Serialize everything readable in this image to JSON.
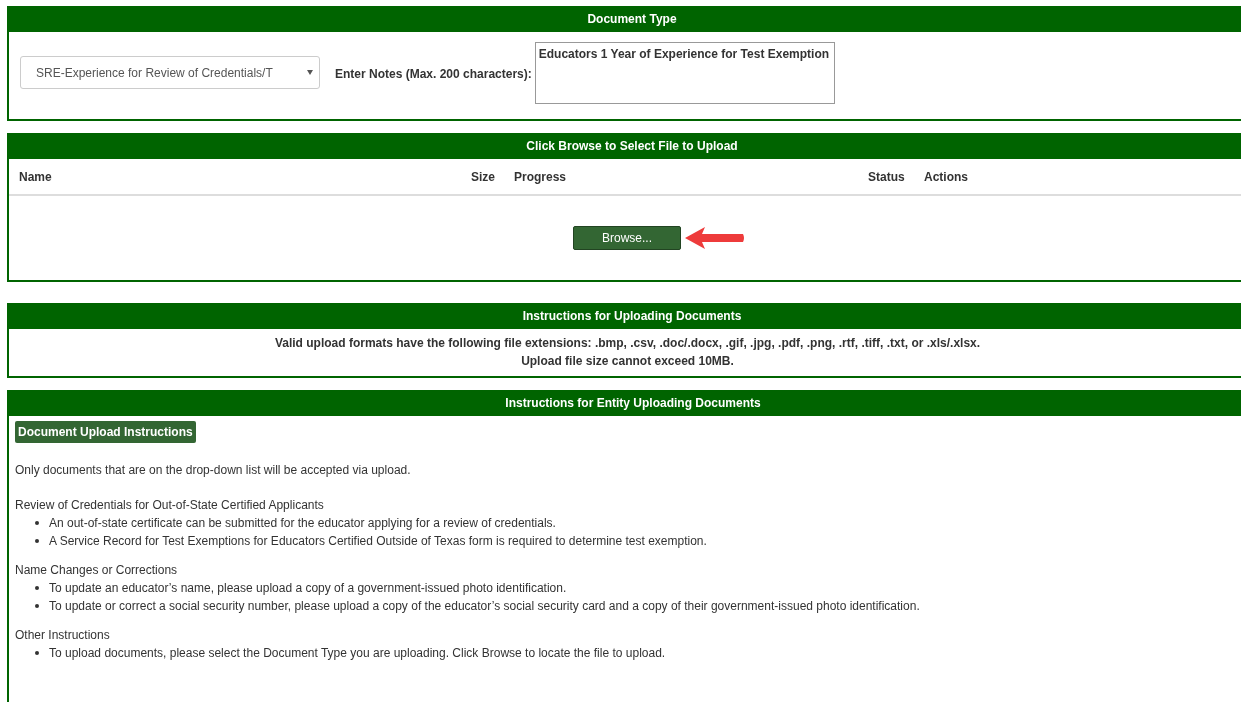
{
  "document_type": {
    "header": "Document Type",
    "select_value": "SRE-Experience for Review of Credentials/T",
    "notes_label": "Enter Notes (Max. 200 characters):",
    "notes_value": "Educators 1 Year of Experience for Test Exemption"
  },
  "upload": {
    "header": "Click Browse to Select File to Upload",
    "columns": [
      "Name",
      "Size",
      "Progress",
      "Status",
      "Actions"
    ],
    "browse_button": "Browse..."
  },
  "instructions": {
    "header": "Instructions for Uploading Documents",
    "lines": [
      "Valid upload formats have the following file extensions: .bmp, .csv, .doc/.docx, .gif, .jpg, .pdf, .png, .rtf, .tiff, .txt, or .xls/.xlsx.",
      "Upload file size cannot exceed 10MB."
    ]
  },
  "entity_instructions": {
    "header": "Instructions for Entity Uploading Documents",
    "badge": "Document Upload Instructions",
    "intro": "Only documents that are on the drop-down list will be accepted via upload.",
    "sections": [
      {
        "title": "Review of Credentials for Out-of-State Certified Applicants",
        "items": [
          "An out-of-state certificate can be submitted for the educator applying for a review of credentials.",
          "A Service Record for Test Exemptions for Educators Certified Outside of Texas form is required to determine test exemption."
        ]
      },
      {
        "title": "Name Changes or Corrections",
        "items": [
          "To update an educator’s name, please upload a copy of a government-issued photo identification.",
          "To update or correct a social security number, please upload a copy of the educator’s social security card and a copy of their government-issued photo identification."
        ]
      },
      {
        "title": "Other Instructions",
        "items": [
          "To upload documents, please select the Document Type you are uploading. Click Browse to locate the file to upload."
        ]
      }
    ]
  }
}
